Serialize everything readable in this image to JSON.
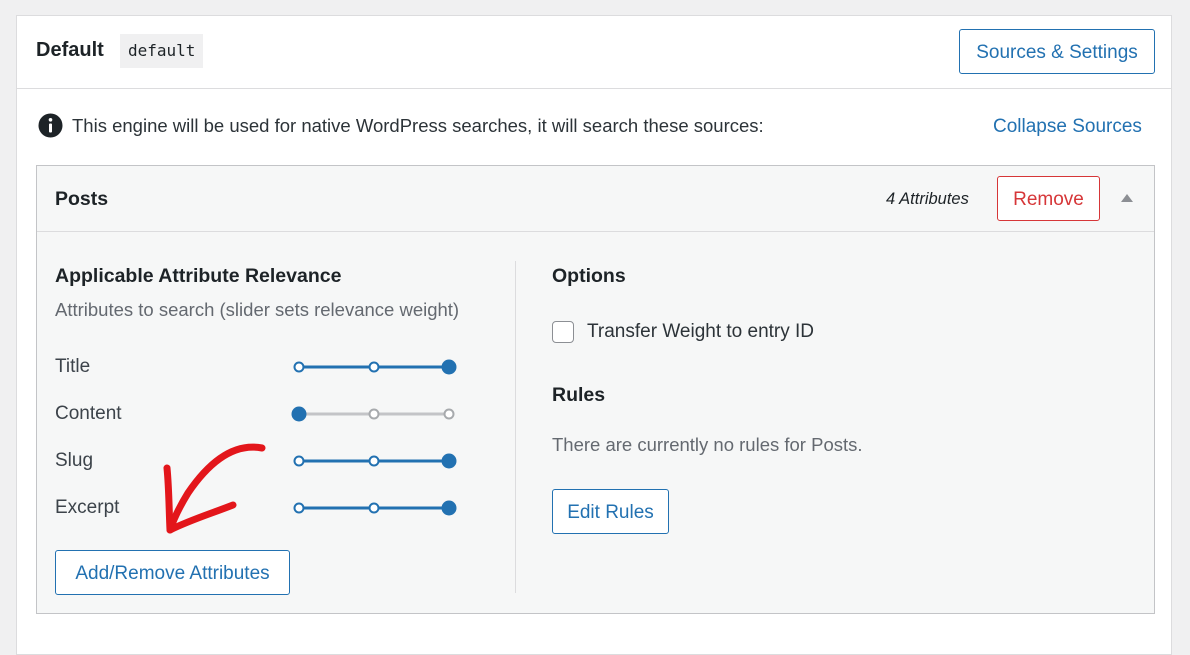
{
  "engine": {
    "label": "Default",
    "code": "default",
    "sources_button": "Sources & Settings",
    "info_icon": "info-icon",
    "info_text": "This engine will be used for native WordPress searches, it will search these sources:",
    "collapse_link": "Collapse Sources"
  },
  "source": {
    "title": "Posts",
    "attribute_count": "4 Attributes",
    "remove_button": "Remove",
    "toggle_icon": "triangle-up-icon",
    "relevance": {
      "heading": "Applicable Attribute Relevance",
      "description": "Attributes to search (slider sets relevance weight)",
      "attributes": [
        {
          "name": "Title",
          "weight": 3,
          "max": 3
        },
        {
          "name": "Content",
          "weight": 1,
          "max": 3
        },
        {
          "name": "Slug",
          "weight": 3,
          "max": 3
        },
        {
          "name": "Excerpt",
          "weight": 3,
          "max": 3
        }
      ],
      "add_remove_button": "Add/Remove Attributes"
    },
    "options": {
      "heading": "Options",
      "transfer_weight_label": "Transfer Weight to entry ID",
      "transfer_weight_checked": false
    },
    "rules": {
      "heading": "Rules",
      "empty_text": "There are currently no rules for Posts.",
      "edit_button": "Edit Rules"
    }
  },
  "colors": {
    "accent": "#2271b1",
    "danger": "#d63638",
    "slider_inactive": "#c3c4c7",
    "annotation": "#e3161b"
  }
}
